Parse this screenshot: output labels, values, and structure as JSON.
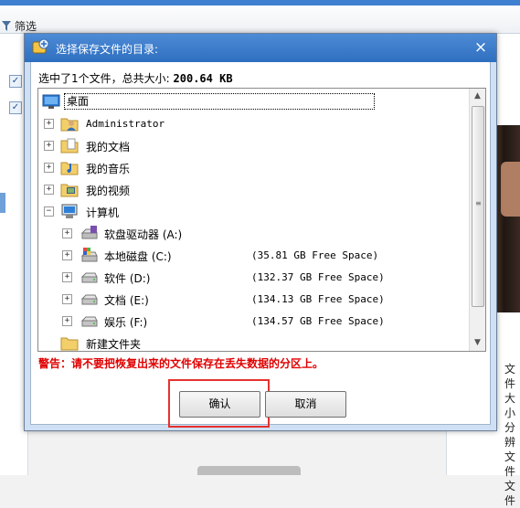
{
  "background": {
    "toolbar_filter_label": "筛选",
    "right_panel_lines": [
      "文件",
      "大小",
      "分辨",
      "文件",
      "文件"
    ]
  },
  "dialog": {
    "title": "选择保存文件的目录:",
    "close_glyph": "×",
    "summary_prefix": "选中了",
    "summary_count": "1",
    "summary_middle": "个文件，总共大小:",
    "summary_size": "200.64 KB",
    "tree": {
      "expand_glyph": "+",
      "collapse_glyph": "−",
      "items": [
        {
          "label": "桌面",
          "icon": "desktop-icon",
          "selected": true
        },
        {
          "label": "Administrator",
          "icon": "user-folder-icon"
        },
        {
          "label": "我的文档",
          "icon": "documents-folder-icon"
        },
        {
          "label": "我的音乐",
          "icon": "music-folder-icon"
        },
        {
          "label": "我的视频",
          "icon": "video-folder-icon"
        },
        {
          "label": "计算机",
          "icon": "computer-icon",
          "expanded": true
        },
        {
          "label": "软盘驱动器 (A:)",
          "icon": "floppy-drive-icon",
          "free": ""
        },
        {
          "label": "本地磁盘 (C:)",
          "icon": "system-drive-icon",
          "free": "(35.81 GB Free Space)"
        },
        {
          "label": "软件 (D:)",
          "icon": "hard-drive-icon",
          "free": "(132.37 GB Free Space)"
        },
        {
          "label": "文档 (E:)",
          "icon": "hard-drive-icon",
          "free": "(134.13 GB Free Space)"
        },
        {
          "label": "娱乐 (F:)",
          "icon": "hard-drive-icon",
          "free": "(134.57 GB Free Space)"
        },
        {
          "label": "新建文件夹",
          "icon": "folder-icon"
        }
      ]
    },
    "scroll_up_glyph": "▲",
    "scroll_down_glyph": "▼",
    "warning": "警告：请不要把恢复出来的文件保存在丢失数据的分区上。",
    "ok_label": "确认",
    "cancel_label": "取消"
  },
  "colors": {
    "title_bar": "#2f6fc0",
    "warning_text": "#e00000",
    "highlight_border": "#e6322e"
  }
}
